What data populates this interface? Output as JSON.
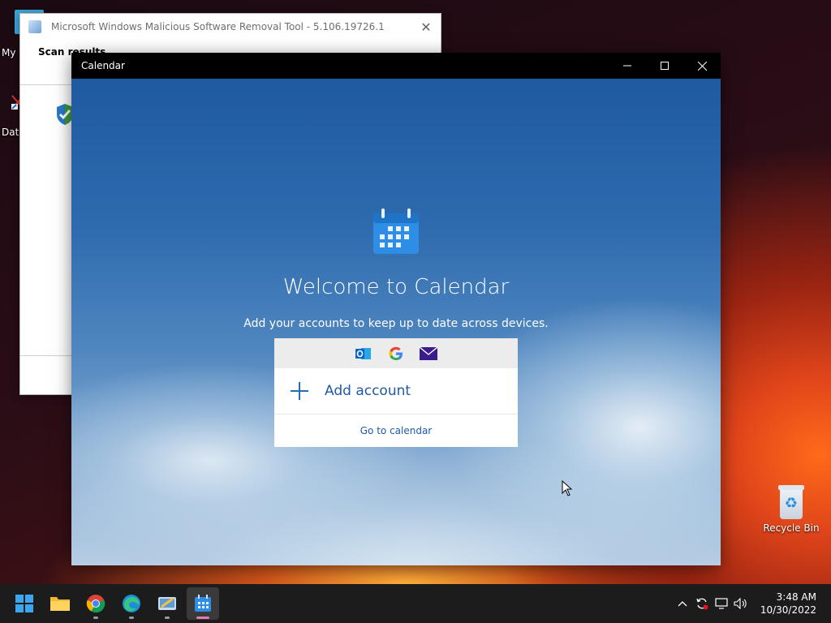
{
  "desktop": {
    "recycle_bin_label": "Recycle Bin",
    "partial_icon_1_label": "My",
    "partial_icon_2_label": "Data"
  },
  "msrt_window": {
    "title": "Microsoft Windows Malicious Software Removal Tool - 5.106.19726.1",
    "heading": "Scan results"
  },
  "calendar_window": {
    "title": "Calendar",
    "welcome_title": "Welcome to Calendar",
    "subtitle": "Add your accounts to keep up to date across devices.",
    "providers": [
      "outlook-icon",
      "google-icon",
      "mail-icon"
    ],
    "add_account_label": "Add account",
    "go_to_calendar_label": "Go to calendar"
  },
  "taskbar": {
    "apps": [
      "start-button",
      "file-explorer",
      "chrome",
      "edge",
      "malicious-software-removal-tool",
      "calendar"
    ],
    "time": "3:48 AM",
    "date": "10/30/2022"
  },
  "colors": {
    "accent_blue": "#1e5aa8",
    "titlebar_black": "#000000",
    "taskbar": "#1c1c1c"
  }
}
